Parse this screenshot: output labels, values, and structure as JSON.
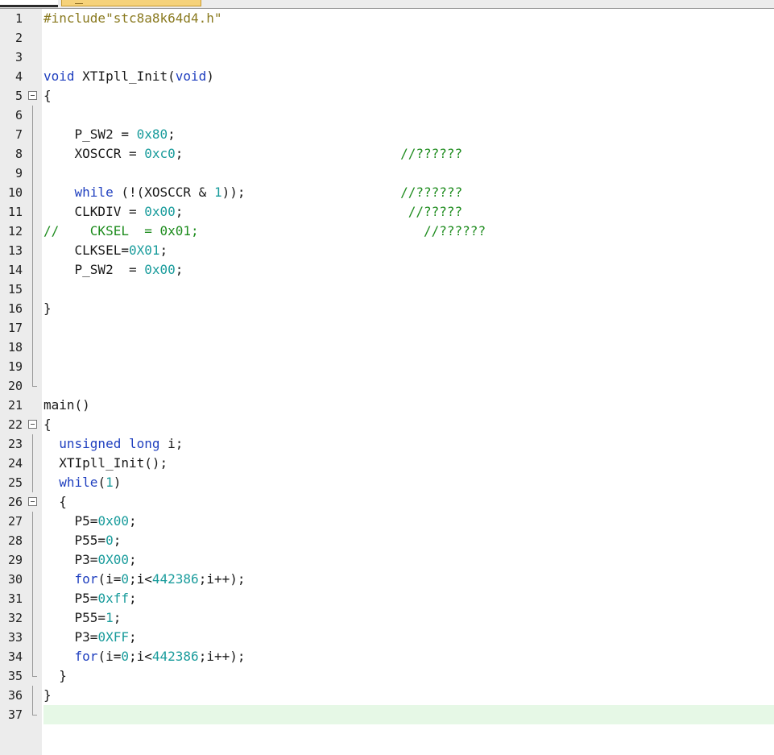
{
  "editor": {
    "current_line": 37,
    "lines": [
      {
        "n": "1",
        "code": "#include\"stc8a8k64d4.h\""
      },
      {
        "n": "2",
        "code": ""
      },
      {
        "n": "3",
        "code": ""
      },
      {
        "n": "4",
        "code": "void XTIpll_Init(void)"
      },
      {
        "n": "5",
        "code": "{"
      },
      {
        "n": "6",
        "code": ""
      },
      {
        "n": "7",
        "code": "    P_SW2 = 0x80;"
      },
      {
        "n": "8",
        "code": "    XOSCCR = 0xc0;                            //??????"
      },
      {
        "n": "9",
        "code": ""
      },
      {
        "n": "10",
        "code": "    while (!(XOSCCR & 1));                    //??????"
      },
      {
        "n": "11",
        "code": "    CLKDIV = 0x00;                             //?????"
      },
      {
        "n": "12",
        "code": "//    CKSEL  = 0x01;                             //??????"
      },
      {
        "n": "13",
        "code": "    CLKSEL=0X01;"
      },
      {
        "n": "14",
        "code": "    P_SW2  = 0x00;"
      },
      {
        "n": "15",
        "code": ""
      },
      {
        "n": "16",
        "code": "}"
      },
      {
        "n": "17",
        "code": ""
      },
      {
        "n": "18",
        "code": ""
      },
      {
        "n": "19",
        "code": ""
      },
      {
        "n": "20",
        "code": ""
      },
      {
        "n": "21",
        "code": "main()"
      },
      {
        "n": "22",
        "code": "{"
      },
      {
        "n": "23",
        "code": "  unsigned long i;"
      },
      {
        "n": "24",
        "code": "  XTIpll_Init();"
      },
      {
        "n": "25",
        "code": "  while(1)"
      },
      {
        "n": "26",
        "code": "  {"
      },
      {
        "n": "27",
        "code": "    P5=0x00;"
      },
      {
        "n": "28",
        "code": "    P55=0;"
      },
      {
        "n": "29",
        "code": "    P3=0X00;"
      },
      {
        "n": "30",
        "code": "    for(i=0;i<442386;i++);"
      },
      {
        "n": "31",
        "code": "    P5=0xff;"
      },
      {
        "n": "32",
        "code": "    P55=1;"
      },
      {
        "n": "33",
        "code": "    P3=0XFF;"
      },
      {
        "n": "34",
        "code": "    for(i=0;i<442386;i++);"
      },
      {
        "n": "35",
        "code": "  }"
      },
      {
        "n": "36",
        "code": "}"
      },
      {
        "n": "37",
        "code": ""
      }
    ]
  },
  "colors": {
    "keyword": "#1f3fbf",
    "number": "#1a9c9c",
    "comment": "#1e8c1e",
    "preprocessor": "#8a7a20",
    "current_line": "#e6f8e6"
  }
}
